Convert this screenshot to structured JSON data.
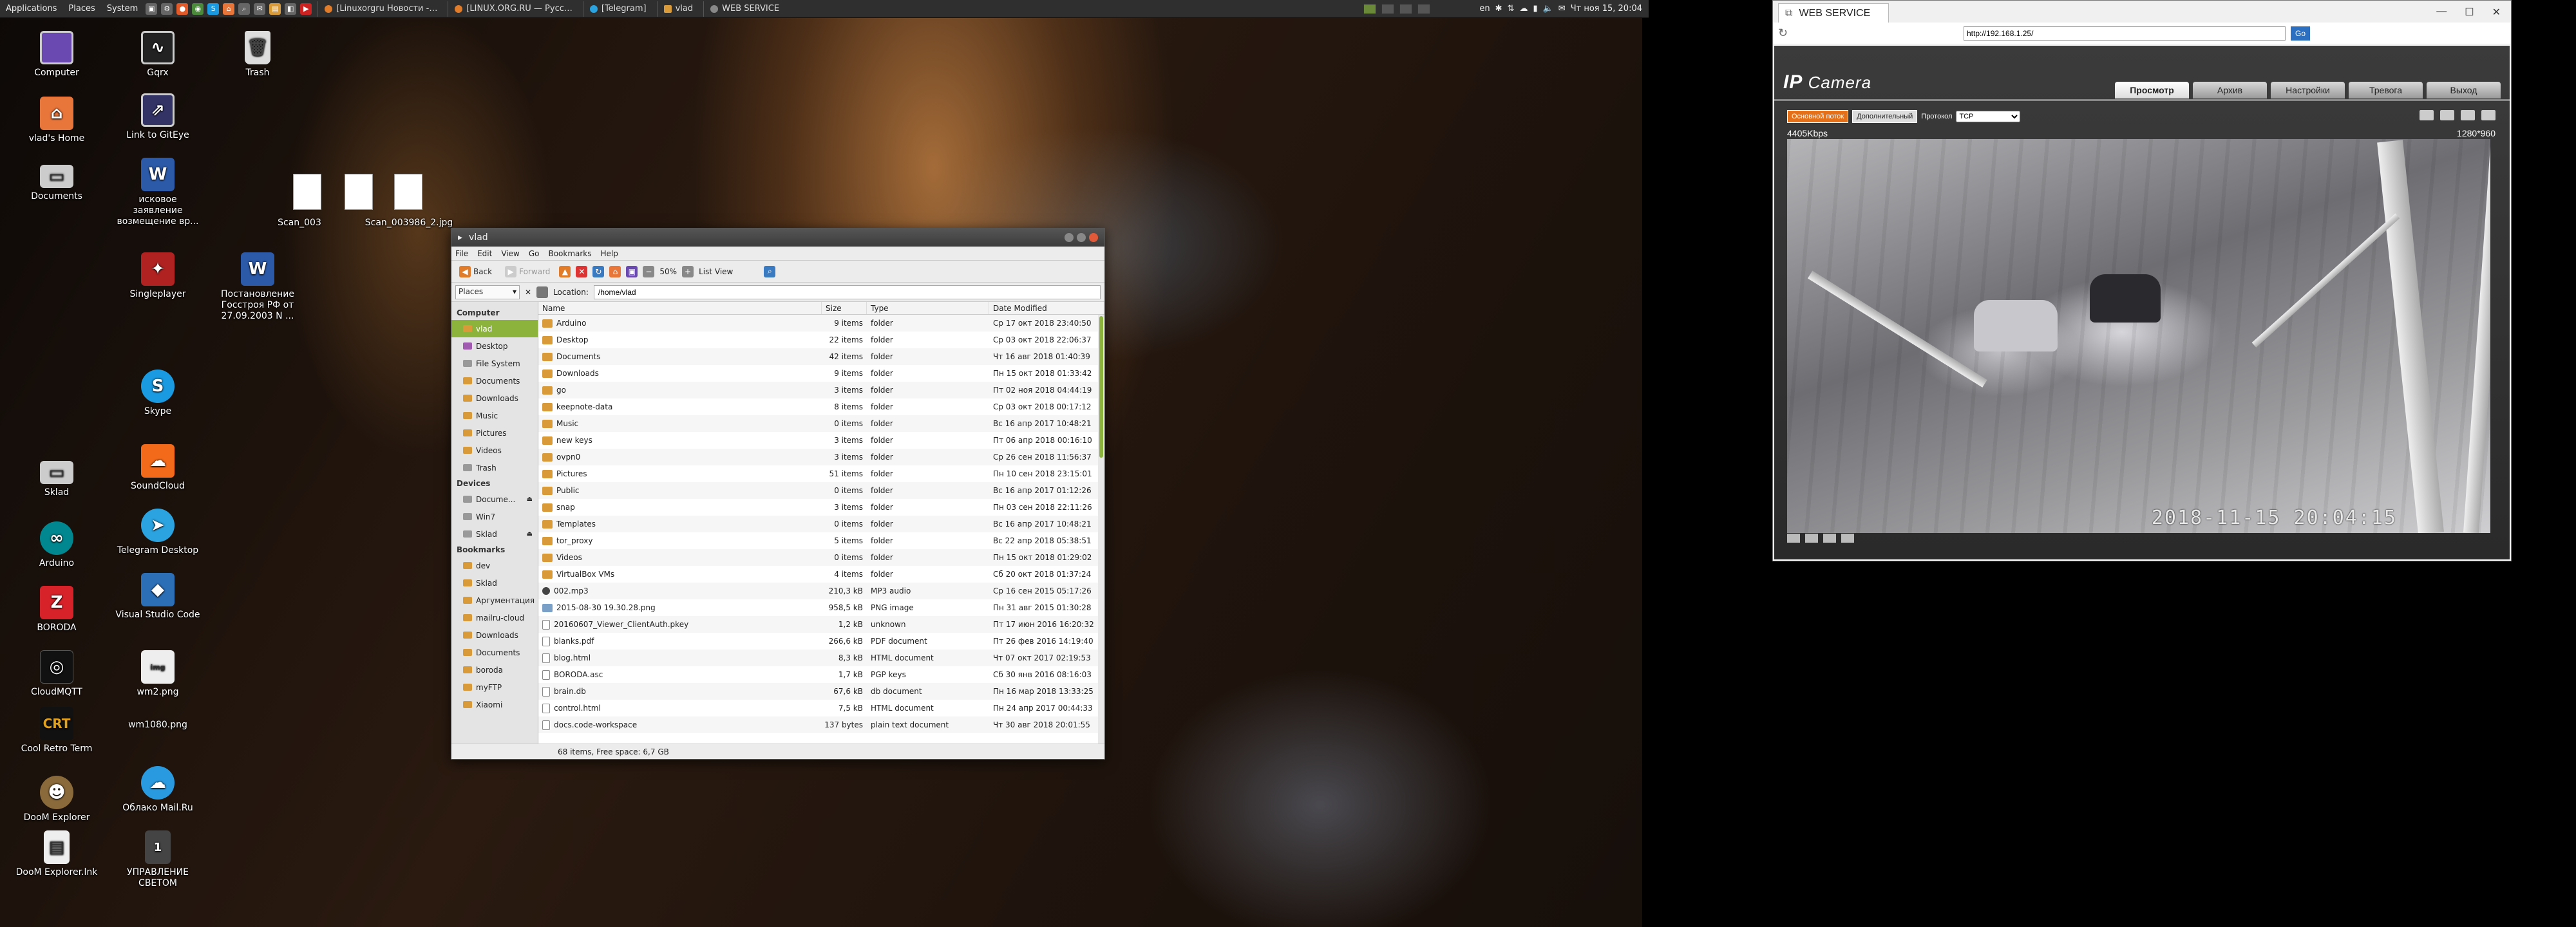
{
  "panel": {
    "menus": [
      "Applications",
      "Places",
      "System"
    ],
    "quick_icons": [
      "terminal-icon",
      "gear-icon",
      "browser-icon",
      "chrome-icon",
      "skype-icon",
      "home-icon",
      "search-icon",
      "mail-icon",
      "files-icon",
      "viewer-icon",
      "video-icon"
    ],
    "tasks": [
      {
        "label": "[Linuxorgru Новости -…",
        "icon": "browser-tab-icon"
      },
      {
        "label": "[LINUX.ORG.RU — Русс…",
        "icon": "browser-tab-icon"
      },
      {
        "label": "[Telegram]",
        "icon": "telegram-icon"
      },
      {
        "label": "vlad",
        "icon": "folder-icon"
      },
      {
        "label": "WEB SERVICE",
        "icon": "app-icon"
      }
    ],
    "keyboard_layout": "en",
    "clock": "Чт ноя 15, 20:04"
  },
  "desktop_icons": [
    {
      "label": "Computer",
      "kind": "monitor"
    },
    {
      "label": "Gqrx",
      "kind": "monitor"
    },
    {
      "label": "Trash",
      "kind": "trash"
    },
    {
      "label": "vlad's Home",
      "kind": "home"
    },
    {
      "label": "Link to GitEye",
      "kind": "monitor"
    },
    {
      "label": "Documents",
      "kind": "drive"
    },
    {
      "label": "исковое заявление возмещение вр...",
      "kind": "word"
    },
    {
      "label": "Scan_003",
      "kind": "thumb"
    },
    {
      "label": "Scan_003986_2.jpg",
      "kind": "thumb"
    },
    {
      "label": "Singleplayer",
      "kind": "game"
    },
    {
      "label": "Постановление Госстроя РФ от 27.09.2003 N ...",
      "kind": "word"
    },
    {
      "label": "Skype",
      "kind": "skype"
    },
    {
      "label": "Sklad",
      "kind": "drive"
    },
    {
      "label": "SoundCloud",
      "kind": "sc"
    },
    {
      "label": "Arduino",
      "kind": "ard"
    },
    {
      "label": "Telegram Desktop",
      "kind": "tg"
    },
    {
      "label": "BORODA",
      "kind": "z"
    },
    {
      "label": "Visual Studio Code",
      "kind": "vs"
    },
    {
      "label": "CloudMQTT",
      "kind": "mqtt"
    },
    {
      "label": "wm2.png",
      "kind": "wm"
    },
    {
      "label": "Cool Retro Term",
      "kind": "crt"
    },
    {
      "label": "wm1080.png",
      "kind": "wm"
    },
    {
      "label": "DooM Explorer",
      "kind": "doom"
    },
    {
      "label": "Облако Mail.Ru",
      "kind": "cloud"
    },
    {
      "label": "DooM Explorer.lnk",
      "kind": "txt"
    },
    {
      "label": "УПРАВЛЕНИЕ СВЕТОМ",
      "kind": "one"
    }
  ],
  "file_manager": {
    "title": "vlad",
    "menu": [
      "File",
      "Edit",
      "View",
      "Go",
      "Bookmarks",
      "Help"
    ],
    "toolbar": {
      "back": "Back",
      "forward": "Forward",
      "zoom": "50%",
      "view": "List View"
    },
    "places_select": "Places",
    "location_label": "Location:",
    "location": "/home/vlad",
    "sidebar": {
      "computer_header": "Computer",
      "computer": [
        "vlad",
        "Desktop",
        "File System",
        "Documents",
        "Downloads",
        "Music",
        "Pictures",
        "Videos",
        "Trash"
      ],
      "devices_header": "Devices",
      "devices": [
        "Docume...",
        "Win7",
        "Sklad"
      ],
      "bookmarks_header": "Bookmarks",
      "bookmarks": [
        "dev",
        "Sklad",
        "Аргументация",
        "mailru-cloud",
        "Downloads",
        "Documents",
        "boroda",
        "myFTP",
        "Xiaomi"
      ]
    },
    "columns": {
      "name": "Name",
      "size": "Size",
      "type": "Type",
      "date": "Date Modified"
    },
    "rows": [
      {
        "name": "Arduino",
        "size": "9 items",
        "type": "folder",
        "date": "Ср 17 окт 2018 23:40:50",
        "icon": "folder"
      },
      {
        "name": "Desktop",
        "size": "22 items",
        "type": "folder",
        "date": "Ср 03 окт 2018 22:06:37",
        "icon": "folder"
      },
      {
        "name": "Documents",
        "size": "42 items",
        "type": "folder",
        "date": "Чт 16 авг 2018 01:40:39",
        "icon": "folder"
      },
      {
        "name": "Downloads",
        "size": "9 items",
        "type": "folder",
        "date": "Пн 15 окт 2018 01:33:42",
        "icon": "folder"
      },
      {
        "name": "go",
        "size": "3 items",
        "type": "folder",
        "date": "Пт 02 ноя 2018 04:44:19",
        "icon": "folder"
      },
      {
        "name": "keepnote-data",
        "size": "8 items",
        "type": "folder",
        "date": "Ср 03 окт 2018 00:17:12",
        "icon": "folder"
      },
      {
        "name": "Music",
        "size": "0 items",
        "type": "folder",
        "date": "Вс 16 апр 2017 10:48:21",
        "icon": "folder"
      },
      {
        "name": "new keys",
        "size": "3 items",
        "type": "folder",
        "date": "Пт 06 апр 2018 00:16:10",
        "icon": "folder"
      },
      {
        "name": "ovpn0",
        "size": "3 items",
        "type": "folder",
        "date": "Ср 26 сен 2018 11:56:37",
        "icon": "folder"
      },
      {
        "name": "Pictures",
        "size": "51 items",
        "type": "folder",
        "date": "Пн 10 сен 2018 23:15:01",
        "icon": "folder"
      },
      {
        "name": "Public",
        "size": "0 items",
        "type": "folder",
        "date": "Вс 16 апр 2017 01:12:26",
        "icon": "folder"
      },
      {
        "name": "snap",
        "size": "3 items",
        "type": "folder",
        "date": "Пн 03 сен 2018 22:11:26",
        "icon": "folder"
      },
      {
        "name": "Templates",
        "size": "0 items",
        "type": "folder",
        "date": "Вс 16 апр 2017 10:48:21",
        "icon": "folder"
      },
      {
        "name": "tor_proxy",
        "size": "5 items",
        "type": "folder",
        "date": "Вс 22 апр 2018 05:38:51",
        "icon": "folder"
      },
      {
        "name": "Videos",
        "size": "0 items",
        "type": "folder",
        "date": "Пн 15 окт 2018 01:29:02",
        "icon": "folder"
      },
      {
        "name": "VirtualBox VMs",
        "size": "4 items",
        "type": "folder",
        "date": "Сб 20 окт 2018 01:37:24",
        "icon": "folder"
      },
      {
        "name": "002.mp3",
        "size": "210,3 kB",
        "type": "MP3 audio",
        "date": "Ср 16 сен 2015 05:17:26",
        "icon": "snd"
      },
      {
        "name": "2015-08-30 19.30.28.png",
        "size": "958,5 kB",
        "type": "PNG image",
        "date": "Пн 31 авг 2015 01:30:28",
        "icon": "img"
      },
      {
        "name": "20160607_Viewer_ClientAuth.pkey",
        "size": "1,2 kB",
        "type": "unknown",
        "date": "Пт 17 июн 2016 16:20:32",
        "icon": "file"
      },
      {
        "name": "blanks.pdf",
        "size": "266,6 kB",
        "type": "PDF document",
        "date": "Пт 26 фев 2016 14:19:40",
        "icon": "file"
      },
      {
        "name": "blog.html",
        "size": "8,3 kB",
        "type": "HTML document",
        "date": "Чт 07 окт 2017 02:19:53",
        "icon": "file"
      },
      {
        "name": "BORODA.asc",
        "size": "1,7 kB",
        "type": "PGP keys",
        "date": "Сб 30 янв 2016 08:16:03",
        "icon": "file"
      },
      {
        "name": "brain.db",
        "size": "67,6 kB",
        "type": "db document",
        "date": "Пн 16 мар 2018 13:33:25",
        "icon": "file"
      },
      {
        "name": "control.html",
        "size": "7,5 kB",
        "type": "HTML document",
        "date": "Пн 24 апр 2017 00:44:33",
        "icon": "file"
      },
      {
        "name": "docs.code-workspace",
        "size": "137 bytes",
        "type": "plain text document",
        "date": "Чт 30 авг 2018 20:01:55",
        "icon": "file"
      }
    ],
    "status": "68 items, Free space: 6,7 GB"
  },
  "web_service": {
    "tab_title": "WEB SERVICE",
    "window_buttons": [
      "—",
      "☐",
      "✕"
    ],
    "url": "http://192.168.1.25/",
    "go": "Go",
    "brand_ip": "IP",
    "brand_camera": "Camera",
    "nav": [
      "Просмотр",
      "Архив",
      "Настройки",
      "Тревога",
      "Выход"
    ],
    "stream_main": "Основной поток",
    "stream_sub": "Дополнительный",
    "protocol_label": "Протокол",
    "protocol_value": "TCP",
    "bitrate": "4405Kbps",
    "resolution": "1280*960",
    "timestamp": "2018-11-15 20:04:15"
  }
}
